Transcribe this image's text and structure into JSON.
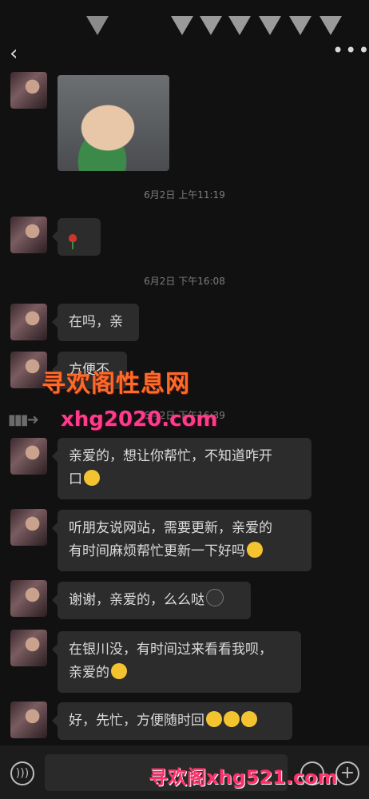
{
  "header": {
    "back_icon": "chevron-left-icon",
    "more_icon": "more-dots-icon",
    "back_glyph": "‹",
    "more_glyph": "•••"
  },
  "messages": [
    {
      "type": "image"
    },
    {
      "type": "time",
      "text": "6月2日 上午11:19"
    },
    {
      "type": "emoji",
      "emoji": "rose"
    },
    {
      "type": "time",
      "text": "6月2日 下午16:08"
    },
    {
      "type": "text",
      "text": "在吗，亲"
    },
    {
      "type": "text",
      "text": "方便不"
    },
    {
      "type": "time",
      "text": "6月2日 下午16:39"
    },
    {
      "type": "text",
      "line1": "亲爱的，想让你帮忙，不知道咋开",
      "line2": "口"
    },
    {
      "type": "text",
      "line1": "听朋友说网站，需要更新，亲爱的",
      "line2": "有时间麻烦帮忙更新一下好吗"
    },
    {
      "type": "text",
      "text": "谢谢，亲爱的，么么哒"
    },
    {
      "type": "text",
      "line1": "在银川没，有时间过来看看我呗，",
      "line2": "亲爱的"
    },
    {
      "type": "text",
      "text": "好，先忙，方便随时回"
    }
  ],
  "watermarks": {
    "top": "寻欢阁性息网",
    "middle": "xhg2020.com",
    "bottom": "寻欢阁xhg521.com"
  },
  "bottom_bar": {
    "voice_icon": "voice-icon",
    "emoji_icon": "emoji-icon",
    "plus_icon": "plus-icon",
    "plus_glyph": "+"
  },
  "colors": {
    "background": "#111111",
    "bubble": "#2c2c2c"
  }
}
